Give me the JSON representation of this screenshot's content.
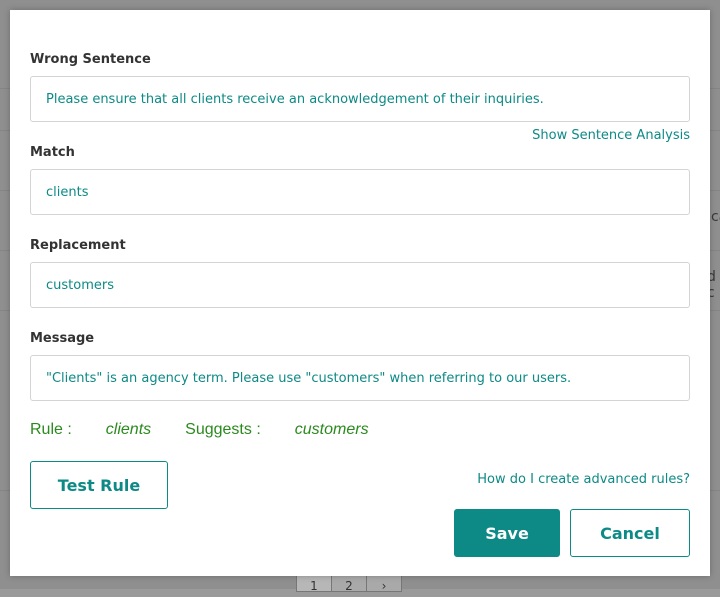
{
  "background": {
    "edge_texts": [
      "ca",
      "d c"
    ],
    "pager": [
      "1",
      "2",
      "›"
    ]
  },
  "form": {
    "wrong_sentence": {
      "label": "Wrong Sentence",
      "value": "Please ensure that all clients receive an acknowledgement of their inquiries."
    },
    "show_analysis_link": "Show Sentence Analysis",
    "match": {
      "label": "Match",
      "value": "clients"
    },
    "replacement": {
      "label": "Replacement",
      "value": "customers"
    },
    "message": {
      "label": "Message",
      "value": "\"Clients\" is an agency term. Please use \"customers\" when referring to our users."
    }
  },
  "rule_summary": {
    "rule_label": "Rule :",
    "rule_value": "clients",
    "suggests_label": "Suggests :",
    "suggests_value": "customers"
  },
  "actions": {
    "test_rule": "Test Rule",
    "advanced_link": "How do I create advanced rules?",
    "save": "Save",
    "cancel": "Cancel"
  },
  "colors": {
    "accent": "#0d8a86",
    "rule_green": "#2b8a1e",
    "label": "#333333",
    "border": "#d4d4d4"
  }
}
